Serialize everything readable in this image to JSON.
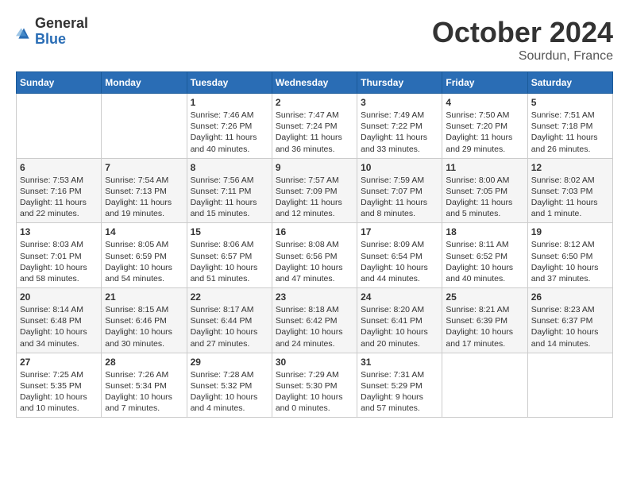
{
  "header": {
    "logo_general": "General",
    "logo_blue": "Blue",
    "month": "October 2024",
    "location": "Sourdun, France"
  },
  "weekdays": [
    "Sunday",
    "Monday",
    "Tuesday",
    "Wednesday",
    "Thursday",
    "Friday",
    "Saturday"
  ],
  "weeks": [
    [
      {
        "day": null
      },
      {
        "day": null
      },
      {
        "day": "1",
        "sunrise": "Sunrise: 7:46 AM",
        "sunset": "Sunset: 7:26 PM",
        "daylight": "Daylight: 11 hours and 40 minutes."
      },
      {
        "day": "2",
        "sunrise": "Sunrise: 7:47 AM",
        "sunset": "Sunset: 7:24 PM",
        "daylight": "Daylight: 11 hours and 36 minutes."
      },
      {
        "day": "3",
        "sunrise": "Sunrise: 7:49 AM",
        "sunset": "Sunset: 7:22 PM",
        "daylight": "Daylight: 11 hours and 33 minutes."
      },
      {
        "day": "4",
        "sunrise": "Sunrise: 7:50 AM",
        "sunset": "Sunset: 7:20 PM",
        "daylight": "Daylight: 11 hours and 29 minutes."
      },
      {
        "day": "5",
        "sunrise": "Sunrise: 7:51 AM",
        "sunset": "Sunset: 7:18 PM",
        "daylight": "Daylight: 11 hours and 26 minutes."
      }
    ],
    [
      {
        "day": "6",
        "sunrise": "Sunrise: 7:53 AM",
        "sunset": "Sunset: 7:16 PM",
        "daylight": "Daylight: 11 hours and 22 minutes."
      },
      {
        "day": "7",
        "sunrise": "Sunrise: 7:54 AM",
        "sunset": "Sunset: 7:13 PM",
        "daylight": "Daylight: 11 hours and 19 minutes."
      },
      {
        "day": "8",
        "sunrise": "Sunrise: 7:56 AM",
        "sunset": "Sunset: 7:11 PM",
        "daylight": "Daylight: 11 hours and 15 minutes."
      },
      {
        "day": "9",
        "sunrise": "Sunrise: 7:57 AM",
        "sunset": "Sunset: 7:09 PM",
        "daylight": "Daylight: 11 hours and 12 minutes."
      },
      {
        "day": "10",
        "sunrise": "Sunrise: 7:59 AM",
        "sunset": "Sunset: 7:07 PM",
        "daylight": "Daylight: 11 hours and 8 minutes."
      },
      {
        "day": "11",
        "sunrise": "Sunrise: 8:00 AM",
        "sunset": "Sunset: 7:05 PM",
        "daylight": "Daylight: 11 hours and 5 minutes."
      },
      {
        "day": "12",
        "sunrise": "Sunrise: 8:02 AM",
        "sunset": "Sunset: 7:03 PM",
        "daylight": "Daylight: 11 hours and 1 minute."
      }
    ],
    [
      {
        "day": "13",
        "sunrise": "Sunrise: 8:03 AM",
        "sunset": "Sunset: 7:01 PM",
        "daylight": "Daylight: 10 hours and 58 minutes."
      },
      {
        "day": "14",
        "sunrise": "Sunrise: 8:05 AM",
        "sunset": "Sunset: 6:59 PM",
        "daylight": "Daylight: 10 hours and 54 minutes."
      },
      {
        "day": "15",
        "sunrise": "Sunrise: 8:06 AM",
        "sunset": "Sunset: 6:57 PM",
        "daylight": "Daylight: 10 hours and 51 minutes."
      },
      {
        "day": "16",
        "sunrise": "Sunrise: 8:08 AM",
        "sunset": "Sunset: 6:56 PM",
        "daylight": "Daylight: 10 hours and 47 minutes."
      },
      {
        "day": "17",
        "sunrise": "Sunrise: 8:09 AM",
        "sunset": "Sunset: 6:54 PM",
        "daylight": "Daylight: 10 hours and 44 minutes."
      },
      {
        "day": "18",
        "sunrise": "Sunrise: 8:11 AM",
        "sunset": "Sunset: 6:52 PM",
        "daylight": "Daylight: 10 hours and 40 minutes."
      },
      {
        "day": "19",
        "sunrise": "Sunrise: 8:12 AM",
        "sunset": "Sunset: 6:50 PM",
        "daylight": "Daylight: 10 hours and 37 minutes."
      }
    ],
    [
      {
        "day": "20",
        "sunrise": "Sunrise: 8:14 AM",
        "sunset": "Sunset: 6:48 PM",
        "daylight": "Daylight: 10 hours and 34 minutes."
      },
      {
        "day": "21",
        "sunrise": "Sunrise: 8:15 AM",
        "sunset": "Sunset: 6:46 PM",
        "daylight": "Daylight: 10 hours and 30 minutes."
      },
      {
        "day": "22",
        "sunrise": "Sunrise: 8:17 AM",
        "sunset": "Sunset: 6:44 PM",
        "daylight": "Daylight: 10 hours and 27 minutes."
      },
      {
        "day": "23",
        "sunrise": "Sunrise: 8:18 AM",
        "sunset": "Sunset: 6:42 PM",
        "daylight": "Daylight: 10 hours and 24 minutes."
      },
      {
        "day": "24",
        "sunrise": "Sunrise: 8:20 AM",
        "sunset": "Sunset: 6:41 PM",
        "daylight": "Daylight: 10 hours and 20 minutes."
      },
      {
        "day": "25",
        "sunrise": "Sunrise: 8:21 AM",
        "sunset": "Sunset: 6:39 PM",
        "daylight": "Daylight: 10 hours and 17 minutes."
      },
      {
        "day": "26",
        "sunrise": "Sunrise: 8:23 AM",
        "sunset": "Sunset: 6:37 PM",
        "daylight": "Daylight: 10 hours and 14 minutes."
      }
    ],
    [
      {
        "day": "27",
        "sunrise": "Sunrise: 7:25 AM",
        "sunset": "Sunset: 5:35 PM",
        "daylight": "Daylight: 10 hours and 10 minutes."
      },
      {
        "day": "28",
        "sunrise": "Sunrise: 7:26 AM",
        "sunset": "Sunset: 5:34 PM",
        "daylight": "Daylight: 10 hours and 7 minutes."
      },
      {
        "day": "29",
        "sunrise": "Sunrise: 7:28 AM",
        "sunset": "Sunset: 5:32 PM",
        "daylight": "Daylight: 10 hours and 4 minutes."
      },
      {
        "day": "30",
        "sunrise": "Sunrise: 7:29 AM",
        "sunset": "Sunset: 5:30 PM",
        "daylight": "Daylight: 10 hours and 0 minutes."
      },
      {
        "day": "31",
        "sunrise": "Sunrise: 7:31 AM",
        "sunset": "Sunset: 5:29 PM",
        "daylight": "Daylight: 9 hours and 57 minutes."
      },
      {
        "day": null
      },
      {
        "day": null
      }
    ]
  ]
}
